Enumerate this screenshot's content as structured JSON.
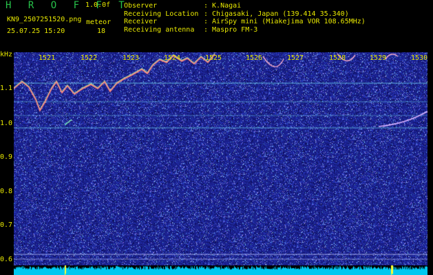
{
  "header": {
    "brand": "H R O F F T",
    "version": "1.0.0f",
    "filename": "KN9_2507251520.png",
    "datetime": "25.07.25 15:20",
    "meteor_label": "meteor",
    "meteor_count": "18"
  },
  "info": [
    {
      "key": "Observer",
      "value": ": K.Nagai"
    },
    {
      "key": "Receiving Location",
      "value": ": Chigasaki, Japan (139.414 35.340)"
    },
    {
      "key": "Receiver",
      "value": ": AirSpy mini (Miakejima VOR 108.65MHz)"
    },
    {
      "key": "Receiving antenna",
      "value": ": Maspro FM-3"
    }
  ],
  "y_axis": {
    "unit": "kHz",
    "labels": [
      "1.1",
      "1.0",
      "0.9",
      "0.8",
      "0.7",
      "0.6"
    ]
  },
  "time_ticks": [
    "1521",
    "1522",
    "1523",
    "1524",
    "1525",
    "1526",
    "1527",
    "1528",
    "1529",
    "1530"
  ],
  "colors": {
    "background": "#000000",
    "spectrum": "#1a1f8c",
    "text": "#e8e800",
    "brand": "#27c24a",
    "signal_line": "#6fd6f0",
    "floor": "#00c8f0"
  }
}
